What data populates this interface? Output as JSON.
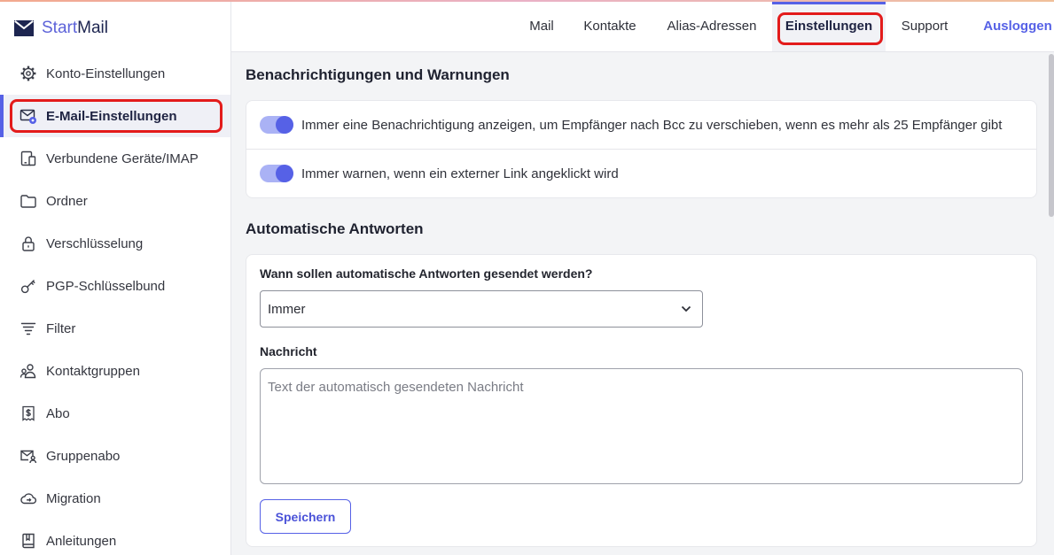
{
  "app": {
    "logo_start": "Start",
    "logo_mail": "Mail"
  },
  "colors": {
    "accent": "#5661e6",
    "annotation": "#e31b1b",
    "toggle_track": "#aab2f5"
  },
  "topnav": {
    "items": [
      {
        "label": "Mail",
        "active": false
      },
      {
        "label": "Kontakte",
        "active": false
      },
      {
        "label": "Alias-Adressen",
        "active": false
      },
      {
        "label": "Einstellungen",
        "active": true
      },
      {
        "label": "Support",
        "active": false
      }
    ],
    "logout_label": "Ausloggen"
  },
  "sidebar": {
    "items": [
      {
        "label": "Konto-Einstellungen",
        "icon": "gear-icon",
        "active": false
      },
      {
        "label": "E-Mail-Einstellungen",
        "icon": "mail-settings-icon",
        "active": true
      },
      {
        "label": "Verbundene Geräte/IMAP",
        "icon": "devices-icon",
        "active": false
      },
      {
        "label": "Ordner",
        "icon": "folder-icon",
        "active": false
      },
      {
        "label": "Verschlüsselung",
        "icon": "lock-icon",
        "active": false
      },
      {
        "label": "PGP-Schlüsselbund",
        "icon": "key-icon",
        "active": false
      },
      {
        "label": "Filter",
        "icon": "filter-icon",
        "active": false
      },
      {
        "label": "Kontaktgruppen",
        "icon": "contact-group-icon",
        "active": false
      },
      {
        "label": "Abo",
        "icon": "receipt-icon",
        "active": false
      },
      {
        "label": "Gruppenabo",
        "icon": "group-mail-icon",
        "active": false
      },
      {
        "label": "Migration",
        "icon": "cloud-migration-icon",
        "active": false
      },
      {
        "label": "Anleitungen",
        "icon": "book-icon",
        "active": false
      }
    ]
  },
  "notifications": {
    "title": "Benachrichtigungen und Warnungen",
    "toggles": [
      {
        "label": "Immer eine Benachrichtigung anzeigen, um Empfänger nach Bcc zu verschieben, wenn es mehr als 25 Empfänger gibt",
        "checked": true
      },
      {
        "label": "Immer warnen, wenn ein externer Link angeklickt wird",
        "checked": true
      }
    ]
  },
  "autoreply": {
    "title": "Automatische Antworten",
    "when_label": "Wann sollen automatische Antworten gesendet werden?",
    "when_value": "Immer",
    "message_label": "Nachricht",
    "message_placeholder": "Text der automatisch gesendeten Nachricht",
    "save_label": "Speichern"
  }
}
